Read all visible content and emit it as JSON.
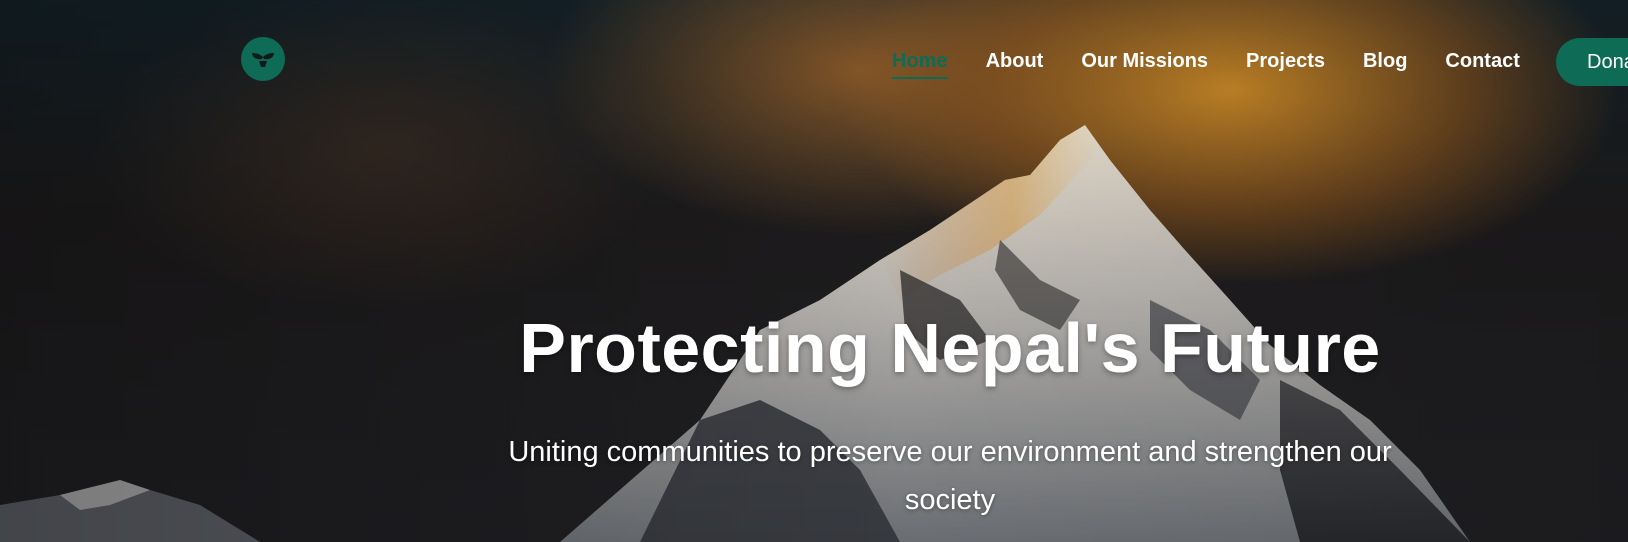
{
  "header": {
    "logo_icon": "sprout-leaf-icon",
    "nav": [
      {
        "label": "Home",
        "active": true
      },
      {
        "label": "About",
        "active": false
      },
      {
        "label": "Our Missions",
        "active": false
      },
      {
        "label": "Projects",
        "active": false
      },
      {
        "label": "Blog",
        "active": false
      },
      {
        "label": "Contact",
        "active": false
      }
    ],
    "donate_label": "Donate"
  },
  "hero": {
    "title": "Protecting Nepal's Future",
    "subtitle": "Uniting communities to preserve our environment and strengthen our society"
  },
  "colors": {
    "brand_green": "#0e6b55",
    "text": "#ffffff"
  }
}
